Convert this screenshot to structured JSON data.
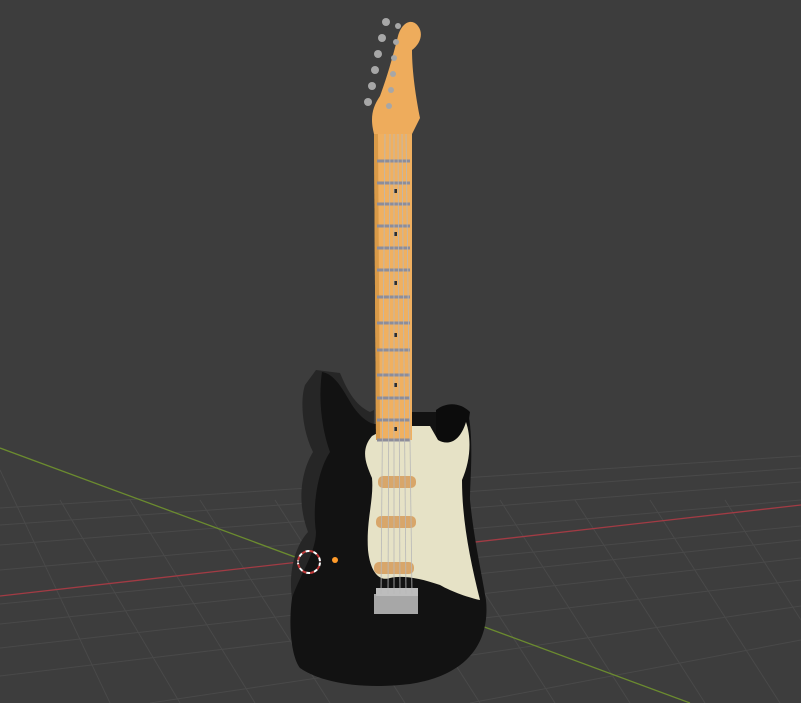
{
  "viewport": {
    "background": "#3d3d3d",
    "grid_color": "#4a4a4a",
    "x_axis_color": "#a23b44",
    "y_axis_color": "#6b8b2f",
    "object": "electric-guitar",
    "body_color": "#111111",
    "pickguard_color": "#e6e2c6",
    "neck_color": "#f0b060",
    "hardware_color": "#a7a7a7"
  }
}
